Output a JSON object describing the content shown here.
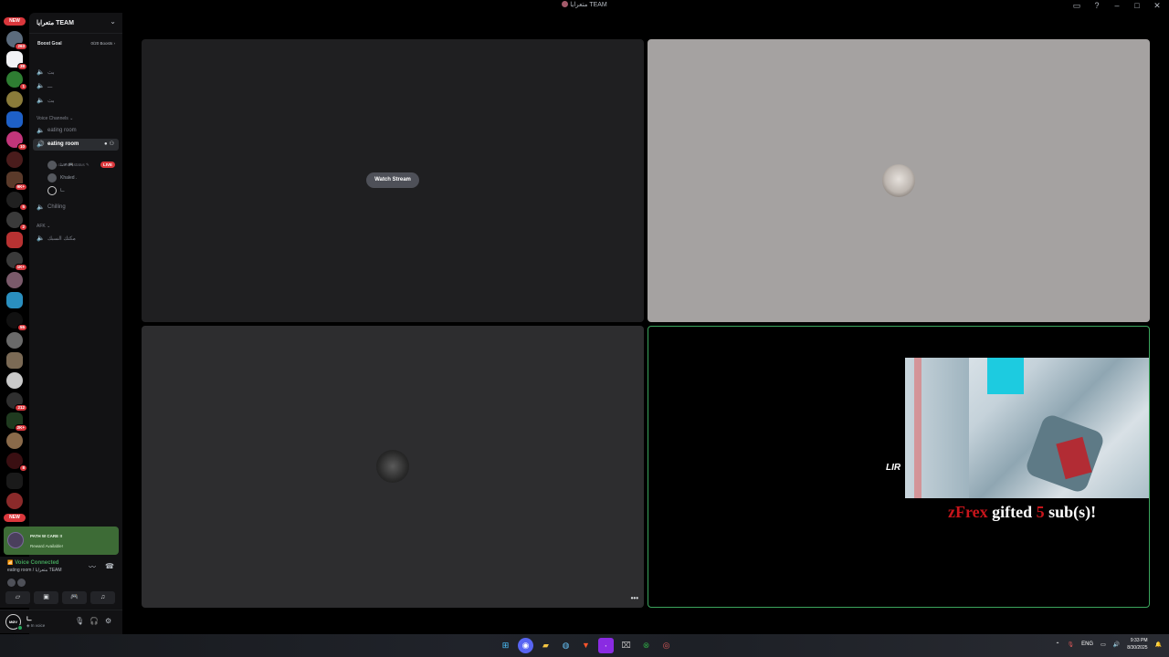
{
  "window": {
    "title": "متعرايا TEAM"
  },
  "window_controls": {
    "inbox": "▭",
    "help": "?",
    "minimize": "–",
    "maximize": "□",
    "close": "✕"
  },
  "rail": {
    "new_top": "NEW",
    "new_bottom": "NEW",
    "servers": [
      {
        "badge": "263",
        "color": "#5b6b7c"
      },
      {
        "badge": "38",
        "color": "#f2f3f5"
      },
      {
        "badge": "1",
        "color": "#2e7d32"
      },
      {
        "badge": "",
        "color": "#8a7b3a"
      },
      {
        "badge": "",
        "color": "#1e60c7"
      },
      {
        "badge": "10",
        "color": "#c2357a"
      },
      {
        "badge": "",
        "color": "#4a1c1c"
      },
      {
        "badge": "9K+",
        "color": "#5a3a2a"
      },
      {
        "badge": "5",
        "color": "#202020"
      },
      {
        "badge": "2",
        "color": "#3a3a3a"
      },
      {
        "badge": "",
        "color": "#b83232"
      },
      {
        "badge": "1K+",
        "color": "#3a3a3a"
      },
      {
        "badge": "",
        "color": "#7a5a6a"
      },
      {
        "badge": "",
        "color": "#2a8fbf"
      },
      {
        "badge": "55",
        "color": "#111"
      },
      {
        "badge": "",
        "color": "#6a6a6a"
      },
      {
        "badge": "",
        "color": "#7b6a55"
      },
      {
        "badge": "",
        "color": "#c9c9c9"
      },
      {
        "badge": "212",
        "color": "#2f2f2f"
      },
      {
        "badge": "2K+",
        "color": "#1f3a1f"
      },
      {
        "badge": "",
        "color": "#8a6a4a"
      },
      {
        "badge": "8",
        "color": "#3a0f12"
      },
      {
        "badge": "",
        "color": "#1a1a1a"
      },
      {
        "badge": "",
        "color": "#8a2a2a"
      }
    ]
  },
  "sidebar": {
    "guild_name": "متعرايا TEAM",
    "boost_goal_label": "Boost Goal",
    "boost_progress": "0/20 Boosts",
    "channels_top": [
      {
        "label": "بث"
      },
      {
        "label": "ـــ"
      },
      {
        "label": "بث"
      }
    ],
    "voice_category": "Voice Channels",
    "channel_eating_1": "eating room",
    "channel_eating_active": "eating room",
    "channel_status_placeholder": "Set a channel status",
    "voice_users": [
      {
        "name": "ــ ≠ 🎮",
        "live": "LIVE"
      },
      {
        "name": "Khaled .",
        "live": ""
      },
      {
        "name": "ــا",
        "live": ""
      }
    ],
    "channel_chilling": "Chilling",
    "afk_category": "AFK",
    "afk_channel": "مكتك السبك"
  },
  "reward": {
    "title": "PATH W CARE !!",
    "subtitle": "Reward Available!"
  },
  "voice_panel": {
    "status": "Voice Connected",
    "location": "eating room / متعرايا TEAM",
    "buttons": [
      "camera",
      "screen-share",
      "activity",
      "soundboard"
    ]
  },
  "user": {
    "name": "ــا",
    "status": "In voice",
    "avatar_text": "MØV"
  },
  "stage": {
    "watch_stream_label": "Watch Stream",
    "more_label": "•••",
    "gift": {
      "user": "zFrex",
      "gifted": "gifted",
      "count": "5",
      "suffix": "sub(s)!"
    },
    "overlay_logo": "LIR"
  },
  "taskbar": {
    "language": "ENG",
    "time": "9:33 PM",
    "date": "8/30/2025"
  },
  "colors": {
    "live_red": "#da373c",
    "voice_green": "#43a25a",
    "speaking_border": "#3ba55d",
    "gift_red": "#c8151b"
  }
}
